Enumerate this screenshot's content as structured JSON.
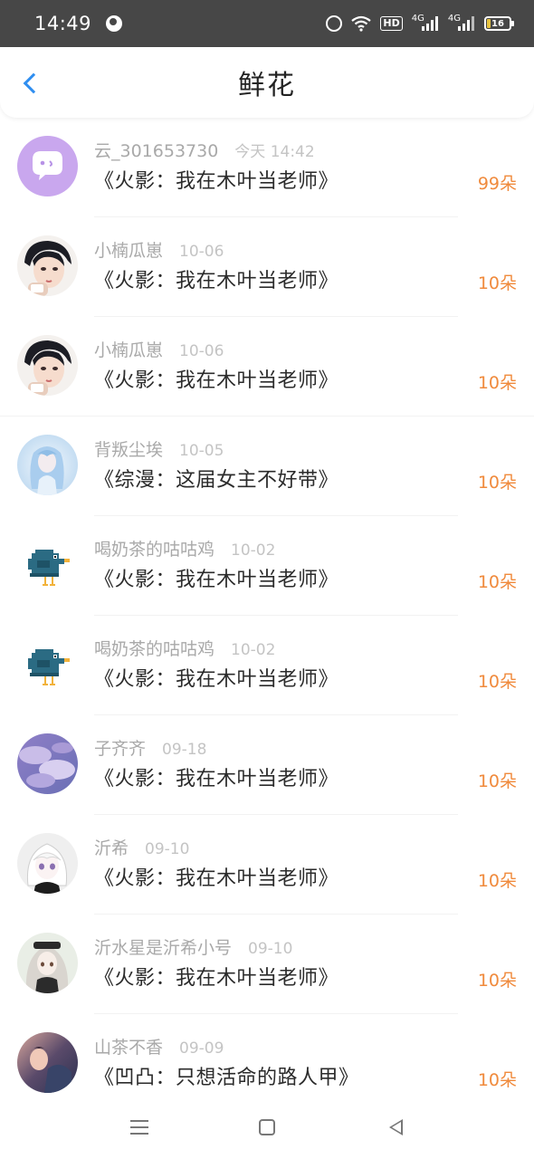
{
  "status_bar": {
    "time": "14:49",
    "hd_label": "HD",
    "network_1": "4G",
    "network_2": "4G",
    "battery_level": "16",
    "battery_fraction": 0.16,
    "battery_color": "#e8c440"
  },
  "header": {
    "title": "鲜花",
    "back_icon": "chevron-left-icon",
    "accent": "#2f8ef0"
  },
  "list": {
    "count_color": "#f08a3c",
    "items": [
      {
        "avatar": "chat-bubble-avatar",
        "user": "云_301653730",
        "time": "今天 14:42",
        "book": "《火影：我在木叶当老师》",
        "count": "99朵"
      },
      {
        "avatar": "anime-boy-avatar",
        "user": "小楠瓜崽",
        "time": "10-06",
        "book": "《火影：我在木叶当老师》",
        "count": "10朵"
      },
      {
        "avatar": "anime-boy-avatar",
        "user": "小楠瓜崽",
        "time": "10-06",
        "book": "《火影：我在木叶当老师》",
        "count": "10朵"
      },
      {
        "avatar": "blue-hair-girl-avatar",
        "user": "背叛尘埃",
        "time": "10-05",
        "book": "《综漫：这届女主不好带》",
        "count": "10朵"
      },
      {
        "avatar": "pixel-bird-avatar",
        "user": "喝奶茶的咕咕鸡",
        "time": "10-02",
        "book": "《火影：我在木叶当老师》",
        "count": "10朵"
      },
      {
        "avatar": "pixel-bird-avatar",
        "user": "喝奶茶的咕咕鸡",
        "time": "10-02",
        "book": "《火影：我在木叶当老师》",
        "count": "10朵"
      },
      {
        "avatar": "purple-clouds-avatar",
        "user": "子齐齐",
        "time": "09-18",
        "book": "《火影：我在木叶当老师》",
        "count": "10朵"
      },
      {
        "avatar": "white-hair-girl-avatar",
        "user": "沂希",
        "time": "09-10",
        "book": "《火影：我在木叶当老师》",
        "count": "10朵"
      },
      {
        "avatar": "silver-hair-girl-avatar",
        "user": "沂水星是沂希小号",
        "time": "09-10",
        "book": "《火影：我在木叶当老师》",
        "count": "10朵"
      },
      {
        "avatar": "painted-figure-avatar",
        "user": "山茶不香",
        "time": "09-09",
        "book": "《凹凸：只想活命的路人甲》",
        "count": "10朵"
      }
    ]
  },
  "nav_bar": {
    "buttons": [
      "menu-icon",
      "home-icon",
      "back-icon"
    ]
  }
}
